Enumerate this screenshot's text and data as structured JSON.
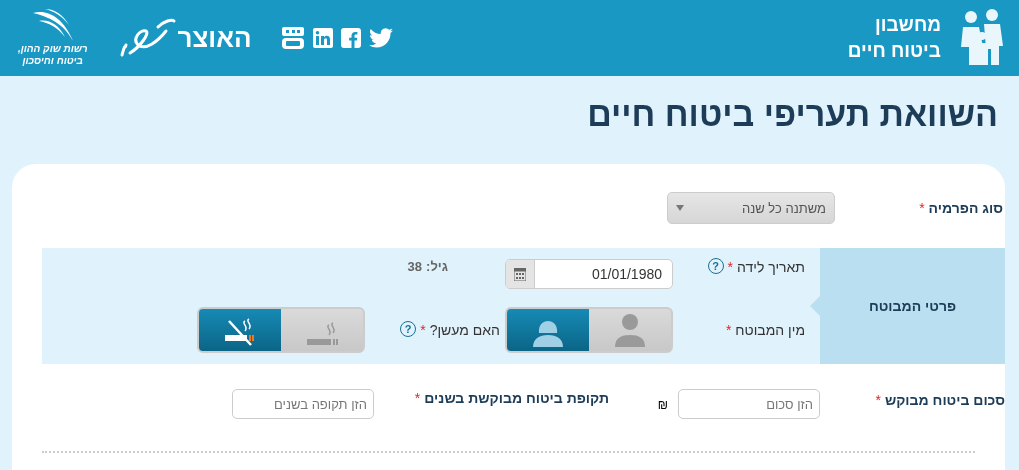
{
  "header": {
    "title_lines": [
      "מחשבון",
      "ביטוח חיים"
    ],
    "ministry": "האוצר",
    "authority_lines": [
      "רשות שוק ההון,",
      "ביטוח וחיסכון"
    ]
  },
  "page_title": "השוואת תעריפי ביטוח חיים",
  "premium_type": {
    "label": "סוג הפרמיה",
    "required_mark": "*",
    "value": "משתנה כל שנה"
  },
  "insured": {
    "section_title": "פרטי המבוטח",
    "birth_date": {
      "label": "תאריך לידה",
      "required_mark": "*",
      "help": "?",
      "value": "01/01/1980"
    },
    "age": {
      "label": "גיל:",
      "value": "38"
    },
    "gender": {
      "label": "מין המבוטח",
      "required_mark": "*",
      "options": [
        {
          "kind": "male",
          "selected": false
        },
        {
          "kind": "female",
          "selected": true
        }
      ]
    },
    "smoker": {
      "label": "האם מעשן?",
      "required_mark": "*",
      "help": "?",
      "options": [
        {
          "kind": "smoker",
          "selected": false
        },
        {
          "kind": "non_smoker",
          "selected": true
        }
      ]
    }
  },
  "coverage": {
    "amount": {
      "label": "סכום ביטוח מבוקש",
      "required_mark": "*",
      "placeholder": "הזן סכום",
      "currency": "₪"
    },
    "period": {
      "label": "תקופת ביטוח מבוקשת בשנים",
      "required_mark": "*",
      "placeholder": "הזן תקופה בשנים"
    }
  }
}
